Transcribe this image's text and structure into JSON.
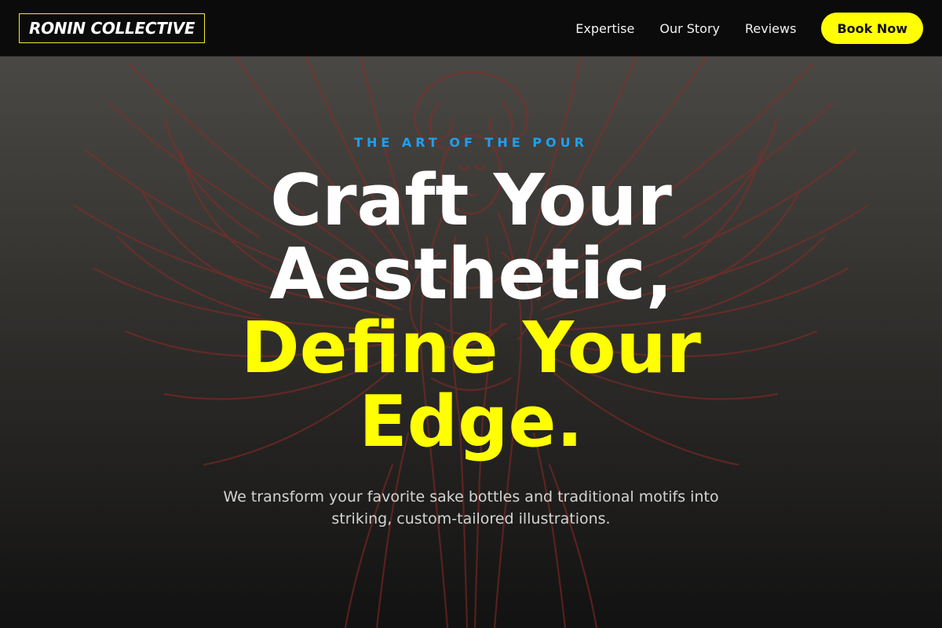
{
  "header": {
    "brand": "RONIN COLLECTIVE",
    "nav": {
      "expertise": "Expertise",
      "our_story": "Our Story",
      "reviews": "Reviews"
    },
    "cta": "Book Now"
  },
  "hero": {
    "eyebrow": "THE ART OF THE POUR",
    "headline": {
      "line1": "Craft Your",
      "line2": "Aesthetic,",
      "line3": "Define Your",
      "line4": "Edge."
    },
    "subtext": "We transform your favorite sake bottles and traditional motifs into striking, custom-tailored illustrations.",
    "background_image": "angel-illustration"
  },
  "colors": {
    "accent_yellow": "#ffff00",
    "eyebrow_blue": "#1ea0ef",
    "illustration_red": "#8e2a24",
    "header_bg": "#0b0b0b"
  }
}
